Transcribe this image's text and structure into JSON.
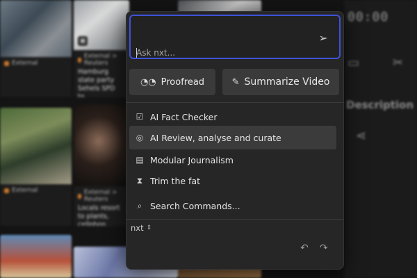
{
  "palette": {
    "search": {
      "placeholder": "Ask nxt..."
    },
    "quick_actions": [
      {
        "label": "Proofread",
        "icon": "glasses-icon"
      },
      {
        "label": "Summarize Video",
        "icon": "pen-icon"
      }
    ],
    "commands": [
      {
        "label": "AI Fact Checker",
        "icon": "checklist-icon",
        "active": false
      },
      {
        "label": "AI Review, analyse and curate",
        "icon": "ai-review-icon",
        "active": true
      },
      {
        "label": "Modular Journalism",
        "icon": "modules-icon",
        "active": false
      },
      {
        "label": "Trim the fat",
        "icon": "hourglass-icon",
        "active": false
      },
      {
        "label": "Search Commands...",
        "icon": "search-icon",
        "active": false
      }
    ],
    "model": "nxt",
    "accent": "#3f52d8"
  },
  "background": {
    "timecode": "00:00",
    "panel_label": "Description",
    "tiles": [
      {
        "source": "External > Reuters",
        "headline": "Hamburg state party Sehels SPD to..."
      },
      {
        "source": "External > Reuters",
        "headline": "Locals resort to plants, cellphon..."
      }
    ]
  }
}
